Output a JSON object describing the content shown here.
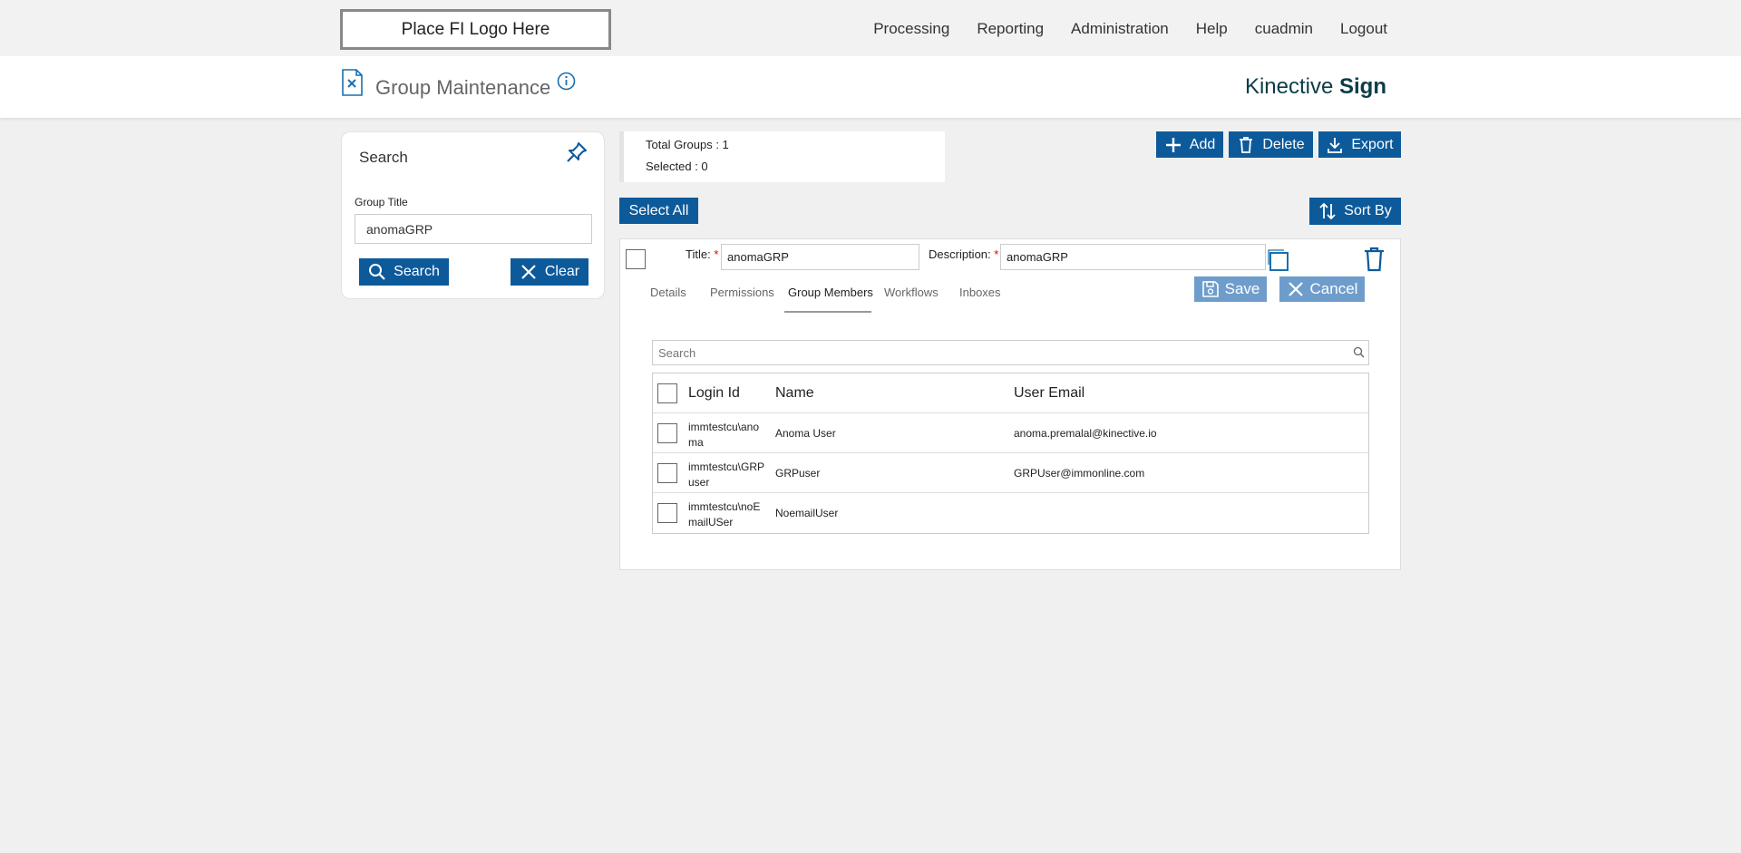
{
  "logo": {
    "text": "Place FI Logo Here"
  },
  "nav": {
    "processing": "Processing",
    "reporting": "Reporting",
    "administration": "Administration",
    "help": "Help",
    "user": "cuadmin",
    "logout": "Logout"
  },
  "header": {
    "title": "Group Maintenance",
    "brand_light": "Kinective",
    "brand_bold": "Sign"
  },
  "search_panel": {
    "title": "Search",
    "field_label": "Group Title",
    "field_value": "anomaGRP",
    "search_label": "Search",
    "clear_label": "Clear"
  },
  "summary": {
    "total_groups": "Total Groups : 1",
    "selected": "Selected : 0"
  },
  "toolbar": {
    "add_label": "Add",
    "delete_label": "Delete",
    "export_label": "Export",
    "select_all_label": "Select All",
    "sort_by_label": "Sort By"
  },
  "group": {
    "title_label": "Title:",
    "title_value": "anomaGRP",
    "description_label": "Description:",
    "description_value": "anomaGRP",
    "required_mark": "*",
    "save_label": "Save",
    "cancel_label": "Cancel",
    "tabs": [
      "Details",
      "Permissions",
      "Group Members",
      "Workflows",
      "Inboxes"
    ],
    "active_tab": "Group Members"
  },
  "members": {
    "search_placeholder": "Search",
    "columns": [
      "Login Id",
      "Name",
      "User Email"
    ],
    "rows": [
      {
        "login": "immtestcu\\anoma",
        "name": "Anoma User",
        "email": "anoma.premalal@kinective.io"
      },
      {
        "login": "immtestcu\\GRPuser",
        "name": "GRPuser",
        "email": "GRPUser@immonline.com"
      },
      {
        "login": "immtestcu\\noEmailUSer",
        "name": "NoemailUser",
        "email": ""
      }
    ]
  },
  "colors": {
    "primary_button": "#0d5a9b",
    "light_button": "#6e9dcc",
    "brand_text": "#0b3d4a",
    "required": "#dd0000"
  }
}
